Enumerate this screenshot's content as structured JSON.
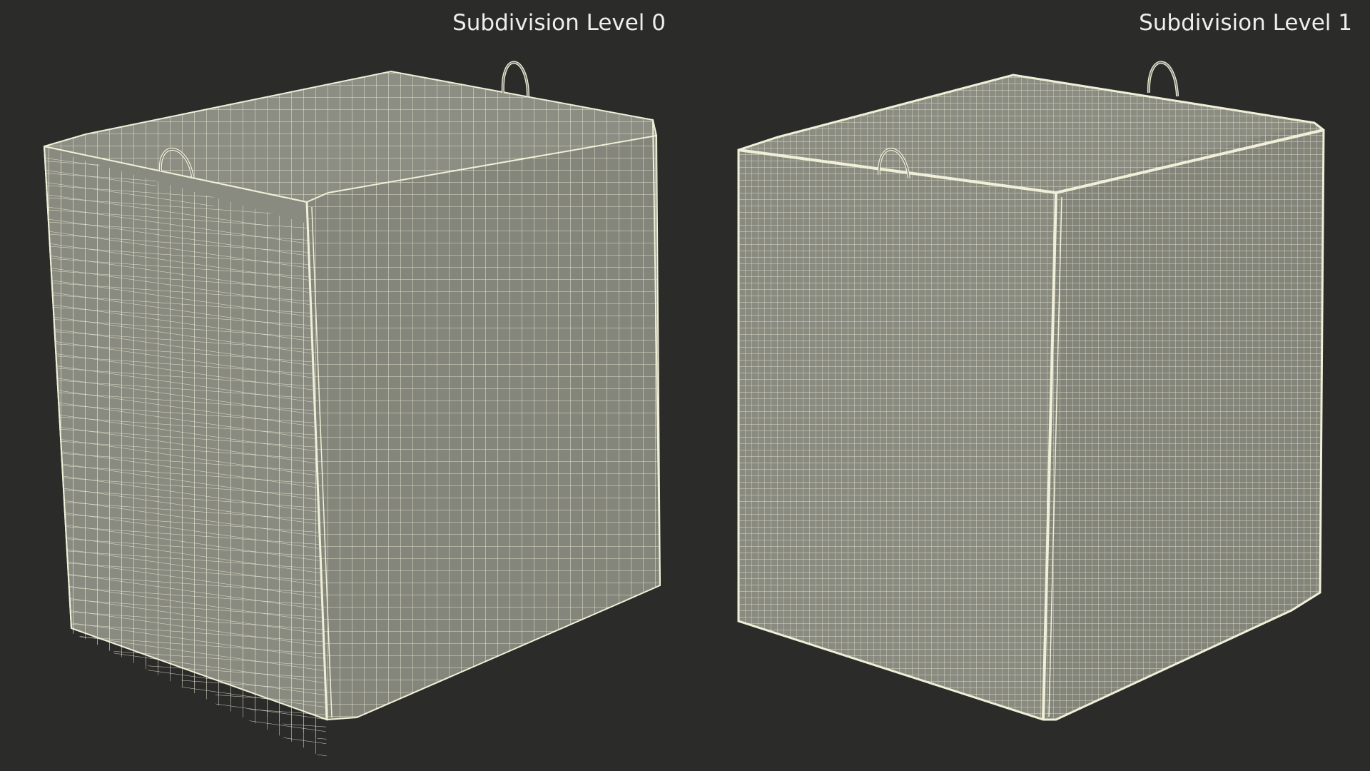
{
  "views": [
    {
      "label": "Subdivision Level 0",
      "grid_density": "coarse"
    },
    {
      "label": "Subdivision Level 1",
      "grid_density": "fine"
    }
  ],
  "colors": {
    "background": "#2b2b2a",
    "mesh_fill_left": "#8a8b80",
    "mesh_fill_right": "#87887e",
    "wireframe": "#f0efd8",
    "label_text": "#eeeeee"
  }
}
